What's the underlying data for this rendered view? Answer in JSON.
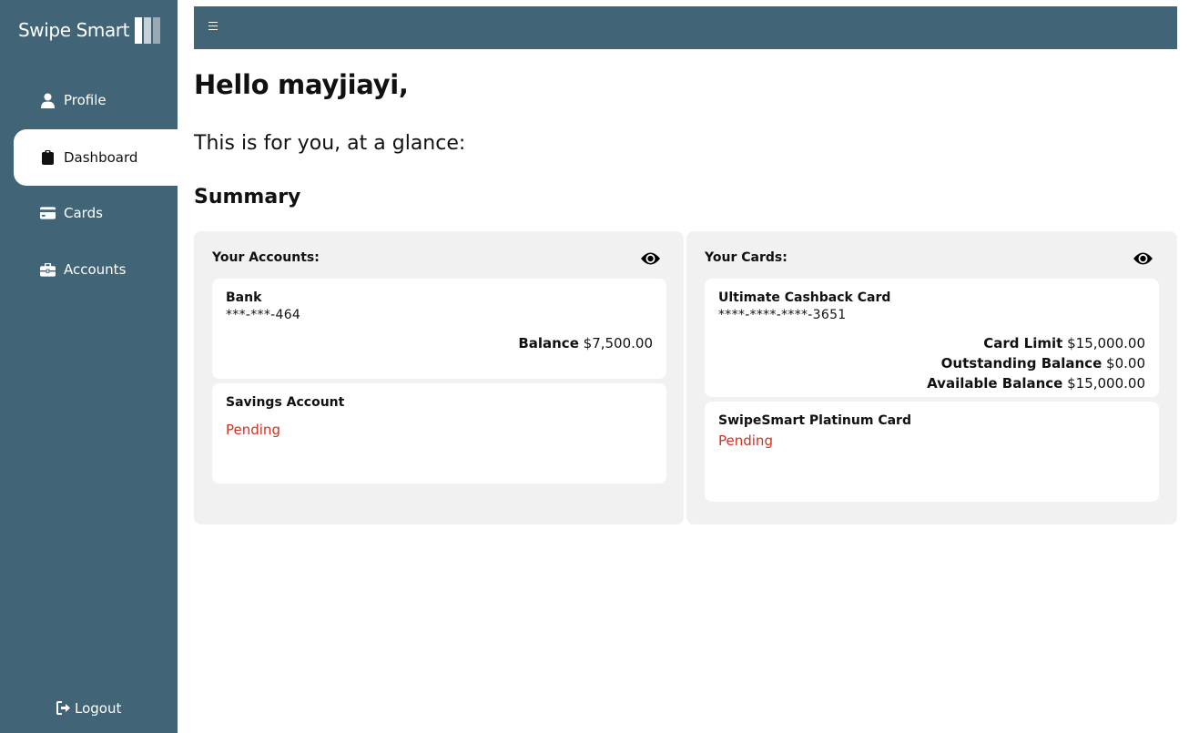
{
  "sidebar": {
    "brand": "Swipe Smart",
    "items": [
      {
        "label": "Profile",
        "icon": "user-icon"
      },
      {
        "label": "Dashboard",
        "icon": "clipboard-icon"
      },
      {
        "label": "Cards",
        "icon": "credit-card-icon"
      },
      {
        "label": "Accounts",
        "icon": "briefcase-icon"
      }
    ],
    "active": "Dashboard",
    "logout": "Logout"
  },
  "topbar": {
    "menu_icon": "hamburger-icon"
  },
  "main": {
    "greeting": "Hello mayjiayi,",
    "subtitle": "This is for you, at a glance:",
    "summary_title": "Summary"
  },
  "accounts_panel": {
    "title": "Your Accounts:",
    "items": [
      {
        "name": "Bank",
        "number": "***-***-464",
        "balance_label": "Balance",
        "balance_value": "$7,500.00"
      },
      {
        "name": "Savings Account",
        "status": "Pending"
      }
    ]
  },
  "cards_panel": {
    "title": "Your Cards:",
    "items": [
      {
        "name": "Ultimate Cashback Card",
        "number": "****-****-****-3651",
        "limit_label": "Card Limit",
        "limit_value": "$15,000.00",
        "outstanding_label": "Outstanding Balance",
        "outstanding_value": "$0.00",
        "available_label": "Available Balance",
        "available_value": "$15,000.00"
      },
      {
        "name": "SwipeSmart Platinum Card",
        "status": "Pending"
      }
    ]
  },
  "colors": {
    "sidebar": "#426477",
    "panel": "#f1f1f1",
    "pending": "#d1321f"
  }
}
